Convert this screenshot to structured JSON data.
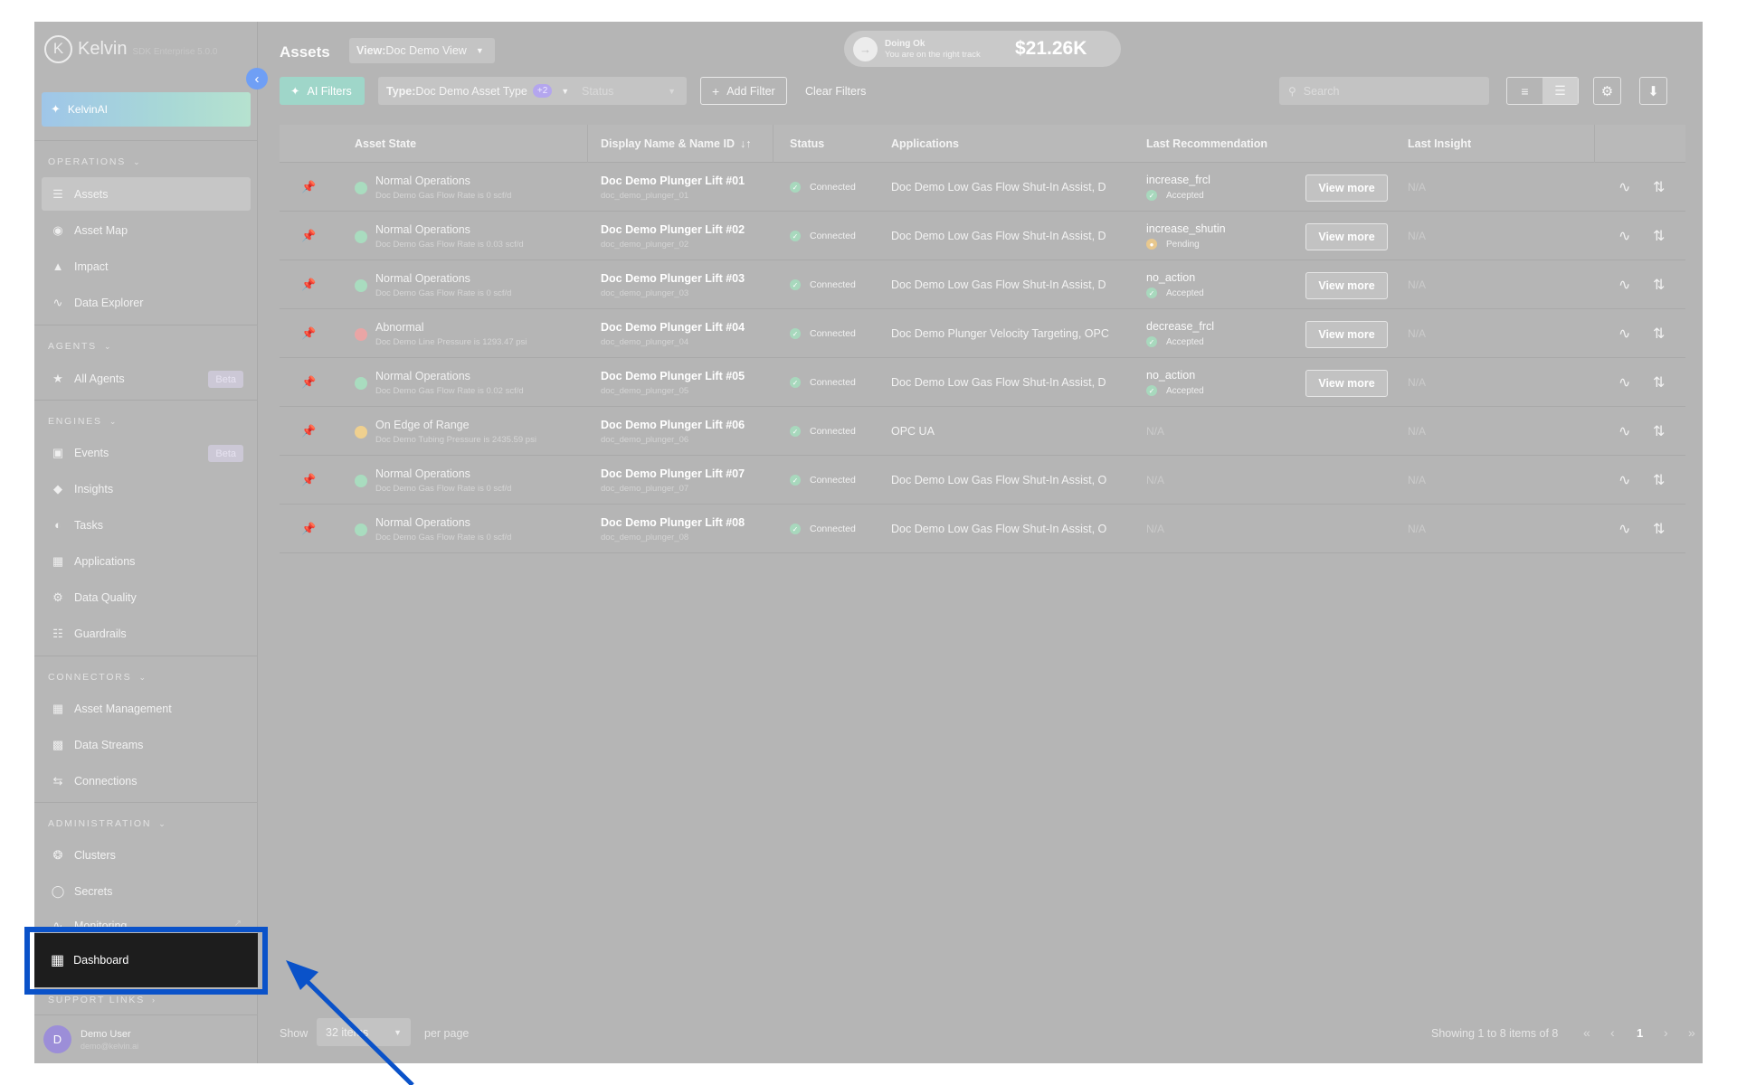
{
  "app": {
    "logo_letter": "K",
    "name": "Kelvin",
    "version": "SDK Enterprise 5.0.0"
  },
  "sidebar": {
    "kelvinai": "KelvinAI",
    "sections": {
      "operations": "OPERATIONS",
      "agents": "AGENTS",
      "engines": "ENGINES",
      "connectors": "CONNECTORS",
      "administration": "ADMINISTRATION",
      "support": "SUPPORT LINKS"
    },
    "items": {
      "assets": "Assets",
      "asset_map": "Asset Map",
      "impact": "Impact",
      "data_explorer": "Data Explorer",
      "all_agents": "All Agents",
      "events": "Events",
      "insights": "Insights",
      "tasks": "Tasks",
      "applications": "Applications",
      "data_quality": "Data Quality",
      "guardrails": "Guardrails",
      "asset_management": "Asset Management",
      "data_streams": "Data Streams",
      "connections": "Connections",
      "clusters": "Clusters",
      "secrets": "Secrets",
      "monitoring": "Monitoring",
      "dashboard": "Dashboard"
    },
    "beta_label": "Beta",
    "user": {
      "initial": "D",
      "name": "Demo User",
      "email": "demo@kelvin.ai"
    }
  },
  "header": {
    "title": "Assets",
    "view_prefix": "View:",
    "view_value": "Doc Demo View",
    "status_title": "Doing Ok",
    "status_sub": "You are on the right track",
    "status_value": "$21.26K"
  },
  "toolbar": {
    "ai_filters": "AI Filters",
    "type_prefix": "Type:",
    "type_value": "Doc Demo Asset Type",
    "type_extra": "+2",
    "status_placeholder": "Status",
    "add_filter": "Add Filter",
    "clear_filters": "Clear Filters",
    "search_placeholder": "Search"
  },
  "table": {
    "headers": {
      "asset_state": "Asset State",
      "display_name": "Display Name & Name ID",
      "sort_icon": "↓↑",
      "status": "Status",
      "applications": "Applications",
      "last_recommendation": "Last Recommendation",
      "last_insight": "Last Insight"
    },
    "view_more": "View more",
    "rows": [
      {
        "state": "Normal Operations",
        "state_color": "#a9dcbf",
        "state_sub": "Doc Demo Gas Flow Rate is 0 scf/d",
        "name": "Doc Demo Plunger Lift #01",
        "name_id": "doc_demo_plunger_01",
        "status": "Connected",
        "apps": "Doc Demo Low Gas Flow Shut-In Assist, D",
        "rec": "increase_frcl",
        "rec_status": "Accepted",
        "rec_kind": "ok",
        "insight": "N/A"
      },
      {
        "state": "Normal Operations",
        "state_color": "#a9dcbf",
        "state_sub": "Doc Demo Gas Flow Rate is 0.03 scf/d",
        "name": "Doc Demo Plunger Lift #02",
        "name_id": "doc_demo_plunger_02",
        "status": "Connected",
        "apps": "Doc Demo Low Gas Flow Shut-In Assist, D",
        "rec": "increase_shutin",
        "rec_status": "Pending",
        "rec_kind": "pending",
        "insight": "N/A"
      },
      {
        "state": "Normal Operations",
        "state_color": "#a9dcbf",
        "state_sub": "Doc Demo Gas Flow Rate is 0 scf/d",
        "name": "Doc Demo Plunger Lift #03",
        "name_id": "doc_demo_plunger_03",
        "status": "Connected",
        "apps": "Doc Demo Low Gas Flow Shut-In Assist, D",
        "rec": "no_action",
        "rec_status": "Accepted",
        "rec_kind": "ok",
        "insight": "N/A"
      },
      {
        "state": "Abnormal",
        "state_color": "#e9a5a5",
        "state_sub": "Doc Demo Line Pressure is 1293.47 psi",
        "name": "Doc Demo Plunger Lift #04",
        "name_id": "doc_demo_plunger_04",
        "status": "Connected",
        "apps": "Doc Demo Plunger Velocity Targeting, OPC",
        "rec": "decrease_frcl",
        "rec_status": "Accepted",
        "rec_kind": "ok",
        "insight": "N/A"
      },
      {
        "state": "Normal Operations",
        "state_color": "#a9dcbf",
        "state_sub": "Doc Demo Gas Flow Rate is 0.02 scf/d",
        "name": "Doc Demo Plunger Lift #05",
        "name_id": "doc_demo_plunger_05",
        "status": "Connected",
        "apps": "Doc Demo Low Gas Flow Shut-In Assist, D",
        "rec": "no_action",
        "rec_status": "Accepted",
        "rec_kind": "ok",
        "insight": "N/A"
      },
      {
        "state": "On Edge of Range",
        "state_color": "#efd08f",
        "state_sub": "Doc Demo Tubing Pressure is 2435.59 psi",
        "name": "Doc Demo Plunger Lift #06",
        "name_id": "doc_demo_plunger_06",
        "status": "Connected",
        "apps": "OPC UA",
        "rec": "N/A",
        "rec_status": "",
        "rec_kind": "none",
        "insight": "N/A"
      },
      {
        "state": "Normal Operations",
        "state_color": "#a9dcbf",
        "state_sub": "Doc Demo Gas Flow Rate is 0 scf/d",
        "name": "Doc Demo Plunger Lift #07",
        "name_id": "doc_demo_plunger_07",
        "status": "Connected",
        "apps": "Doc Demo Low Gas Flow Shut-In Assist, O",
        "rec": "N/A",
        "rec_status": "",
        "rec_kind": "none",
        "insight": "N/A"
      },
      {
        "state": "Normal Operations",
        "state_color": "#a9dcbf",
        "state_sub": "Doc Demo Gas Flow Rate is 0 scf/d",
        "name": "Doc Demo Plunger Lift #08",
        "name_id": "doc_demo_plunger_08",
        "status": "Connected",
        "apps": "Doc Demo Low Gas Flow Shut-In Assist, O",
        "rec": "N/A",
        "rec_status": "",
        "rec_kind": "none",
        "insight": "N/A"
      }
    ]
  },
  "footer": {
    "show": "Show",
    "per_page_value": "32 items",
    "per_page": "per page",
    "showing": "Showing 1 to 8 items of 8",
    "current_page": "1"
  },
  "annotation": {
    "highlight_color": "#0a52c9"
  }
}
